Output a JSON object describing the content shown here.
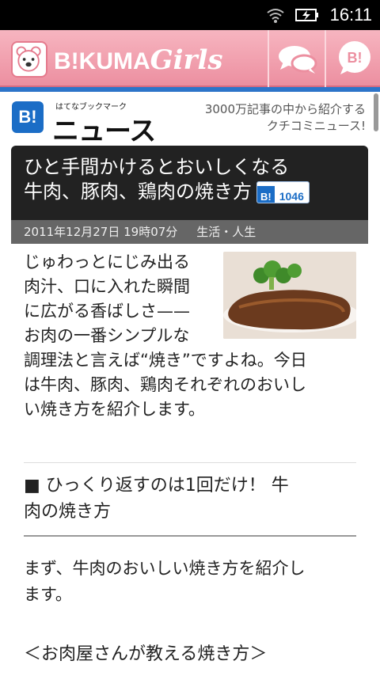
{
  "status_bar": {
    "time": "16:11"
  },
  "app_header": {
    "brand_prefix": "B!KUMA",
    "brand_suffix": "Girls",
    "chat_button_label": "",
    "bookmark_button_label": "B!"
  },
  "news_header": {
    "logo_mark": "B!",
    "subtitle": "はてなブックマーク",
    "title": "ニュース",
    "tagline_line1": "3000万記事の中から紹介する",
    "tagline_line2": "クチコミニュース!"
  },
  "article": {
    "headline_line1": "ひと手間かけるとおいしくなる",
    "headline_line2": "牛肉、豚肉、鶏肉の焼き方",
    "bookmark_badge_mark": "B!",
    "bookmark_count": "1046",
    "date": "2011年12月27日 19時07分",
    "category": "生活・人生",
    "intro_lines_wrapped": [
      "じゅわっとにじみ出る",
      "肉汁、口に入れた瞬間",
      "に広がる香ばしさ——",
      "お肉の一番シンプルな"
    ],
    "intro_lines_full": [
      "調理法と言えば“焼き”ですよね。今日",
      "は牛肉、豚肉、鶏肉それぞれのおいし",
      "い焼き方を紹介します。"
    ],
    "section_title_line1": "■ ひっくり返すのは1回だけ！ 牛",
    "section_title_line2": "肉の焼き方",
    "body_line1": "まず、牛肉のおいしい焼き方を紹介し",
    "body_line2": "ます。",
    "subheading": "＜お肉屋さんが教える焼き方＞"
  }
}
